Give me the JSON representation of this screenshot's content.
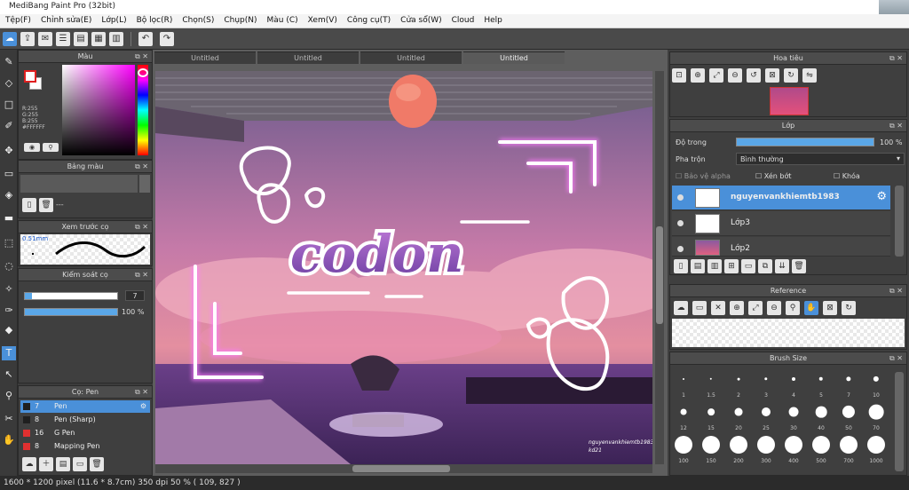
{
  "window": {
    "title": "MediBang Paint Pro (32bit)"
  },
  "menu": [
    "Tệp(F)",
    "Chỉnh sửa(E)",
    "Lớp(L)",
    "Bộ lọc(R)",
    "Chọn(S)",
    "Chụp(N)",
    "Màu (C)",
    "Xem(V)",
    "Công cụ(T)",
    "Cửa sổ(W)",
    "Cloud",
    "Help"
  ],
  "color_panel": {
    "title": "Màu",
    "rgb_text": [
      "R:255",
      "G:255",
      "B:255",
      "#FFFFFF"
    ],
    "fg_color": "#FFFFFF",
    "bg_color": "#FFFFFF"
  },
  "palette_panel": {
    "title": "Bảng màu",
    "value": "---"
  },
  "preview_panel": {
    "title": "Xem trước cọ",
    "size": "0.51mm"
  },
  "brush_control": {
    "title": "Kiểm soát cọ",
    "size_value": "7",
    "opacity_value": "100 %",
    "size_fraction": 0.08,
    "opacity_fraction": 1.0
  },
  "brush_list": {
    "title": "Cọ: Pen",
    "items": [
      {
        "size": "7",
        "name": "Pen",
        "color": "#1f1f1f",
        "selected": true
      },
      {
        "size": "8",
        "name": "Pen (Sharp)",
        "color": "#1f1f1f"
      },
      {
        "size": "16",
        "name": "G Pen",
        "color": "#e03030"
      },
      {
        "size": "8",
        "name": "Mapping Pen",
        "color": "#e03030"
      }
    ]
  },
  "canvas": {
    "tabs": [
      "Untitled",
      "Untitled",
      "Untitled",
      "Untitled"
    ],
    "art_title": "codon",
    "signature": "nguyenvankhiemtb1983",
    "signature2": "kd21"
  },
  "navigator": {
    "title": "Hoa tiêu"
  },
  "layers": {
    "title": "Lớp",
    "opacity_label": "Độ trong",
    "opacity_value": "100 %",
    "opacity_fraction": 1.0,
    "blend_label": "Pha trộn",
    "blend_value": "Bình thường",
    "protect_alpha": "Bảo vệ alpha",
    "clipping": "Xén bớt",
    "lock": "Khóa",
    "items": [
      {
        "name": "nguyenvankhiemtb1983",
        "selected": true
      },
      {
        "name": "Lớp3"
      },
      {
        "name": "Lớp2"
      }
    ]
  },
  "reference": {
    "title": "Reference"
  },
  "brush_size": {
    "title": "Brush Size",
    "sizes": [
      "1",
      "1.5",
      "2",
      "3",
      "4",
      "5",
      "7",
      "10",
      "12",
      "15",
      "20",
      "25",
      "30",
      "40",
      "50",
      "70",
      "100",
      "150",
      "200",
      "300",
      "400",
      "500",
      "700",
      "1000"
    ]
  },
  "status": {
    "text": "1600 * 1200 pixel   (11.6 * 8.7cm)   350 dpi   50 %   ( 109, 827 )"
  }
}
